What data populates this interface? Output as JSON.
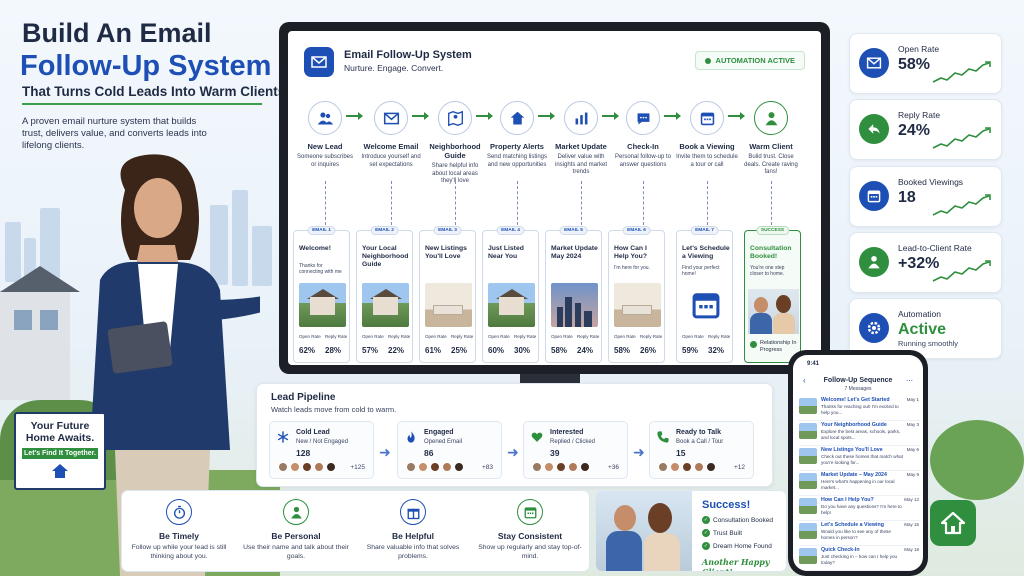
{
  "hero": {
    "title_line1": "Build An Email",
    "title_line2": "Follow-Up System",
    "title_line3": "That Turns Cold Leads Into Warm Clients",
    "description": "A proven email nurture system that builds trust, delivers value, and converts leads into lifelong clients."
  },
  "yard_sign": {
    "line1": "Your Future",
    "line2": "Home Awaits.",
    "band": "Let's Find It Together."
  },
  "app": {
    "title": "Email Follow-Up System",
    "subtitle": "Nurture. Engage. Convert.",
    "status": "AUTOMATION ACTIVE"
  },
  "steps": [
    {
      "name": "New Lead",
      "desc": "Someone subscribes or inquires",
      "icon": "people-icon"
    },
    {
      "name": "Welcome Email",
      "desc": "Introduce yourself and set expectations",
      "icon": "envelope-icon"
    },
    {
      "name": "Neighborhood Guide",
      "desc": "Share helpful info about local areas they'll love",
      "icon": "map-icon"
    },
    {
      "name": "Property Alerts",
      "desc": "Send matching listings and new opportunities",
      "icon": "house-icon"
    },
    {
      "name": "Market Update",
      "desc": "Deliver value with insights and market trends",
      "icon": "bar-chart-icon"
    },
    {
      "name": "Check-In",
      "desc": "Personal follow-up to answer questions",
      "icon": "chat-icon"
    },
    {
      "name": "Book a Viewing",
      "desc": "Invite them to schedule a tour or call",
      "icon": "calendar-icon"
    },
    {
      "name": "Warm Client",
      "desc": "Build trust. Close deals. Create raving fans!",
      "icon": "person-icon"
    }
  ],
  "emails": [
    {
      "tag": "EMAIL 1",
      "title": "Welcome!",
      "sub": "Thanks for connecting with me",
      "open_label": "Open Rate",
      "reply_label": "Reply Rate",
      "open": "62%",
      "reply": "28%"
    },
    {
      "tag": "EMAIL 2",
      "title": "Your Local Neighborhood Guide",
      "sub": "",
      "open_label": "Open Rate",
      "reply_label": "Reply Rate",
      "open": "57%",
      "reply": "22%"
    },
    {
      "tag": "EMAIL 3",
      "title": "New Listings You'll Love",
      "sub": "",
      "open_label": "Open Rate",
      "reply_label": "Reply Rate",
      "open": "61%",
      "reply": "25%"
    },
    {
      "tag": "EMAIL 4",
      "title": "Just Listed Near You",
      "sub": "",
      "open_label": "Open Rate",
      "reply_label": "Reply Rate",
      "open": "60%",
      "reply": "30%"
    },
    {
      "tag": "EMAIL 5",
      "title": "Market Update May 2024",
      "sub": "",
      "open_label": "Open Rate",
      "reply_label": "Reply Rate",
      "open": "58%",
      "reply": "24%"
    },
    {
      "tag": "EMAIL 6",
      "title": "How Can I Help You?",
      "sub": "I'm here for you.",
      "open_label": "Open Rate",
      "reply_label": "Reply Rate",
      "open": "58%",
      "reply": "26%"
    },
    {
      "tag": "EMAIL 7",
      "title": "Let's Schedule a Viewing",
      "sub": "Find your perfect home!",
      "open_label": "Open Rate",
      "reply_label": "Reply Rate",
      "open": "59%",
      "reply": "32%"
    }
  ],
  "success_card": {
    "tag": "SUCCESS",
    "title": "Consultation Booked!",
    "sub": "You're one step closer to home.",
    "footer": "Relationship In Progress"
  },
  "metrics": [
    {
      "label": "Open Rate",
      "value": "58%",
      "color": "#1d4fb5",
      "icon": "envelope-icon"
    },
    {
      "label": "Reply Rate",
      "value": "24%",
      "color": "#2f8f3e",
      "icon": "reply-icon"
    },
    {
      "label": "Booked Viewings",
      "value": "18",
      "color": "#1d4fb5",
      "icon": "calendar-icon"
    },
    {
      "label": "Lead-to-Client Rate",
      "value": "+32%",
      "color": "#2f8f3e",
      "icon": "person-icon"
    }
  ],
  "automation": {
    "label": "Automation",
    "value": "Active",
    "sub": "Running smoothly"
  },
  "pipeline": {
    "title": "Lead Pipeline",
    "subtitle": "Watch leads move from cold to warm.",
    "stages": [
      {
        "name": "Cold Lead",
        "desc": "New / Not Engaged",
        "count": "128",
        "more": "+125",
        "icon": "snowflake-icon"
      },
      {
        "name": "Engaged",
        "desc": "Opened Email",
        "count": "86",
        "more": "+83",
        "icon": "flame-icon"
      },
      {
        "name": "Interested",
        "desc": "Replied / Clicked",
        "count": "39",
        "more": "+36",
        "icon": "heart-icon"
      },
      {
        "name": "Ready to Talk",
        "desc": "Book a Call / Tour",
        "count": "15",
        "more": "+12",
        "icon": "phone-icon"
      }
    ]
  },
  "tips": [
    {
      "name": "Be Timely",
      "desc": "Follow up while your lead is still thinking about you.",
      "icon": "stopwatch-icon"
    },
    {
      "name": "Be Personal",
      "desc": "Use their name and talk about their goals.",
      "icon": "person-icon"
    },
    {
      "name": "Be Helpful",
      "desc": "Share valuable info that solves problems.",
      "icon": "gift-icon"
    },
    {
      "name": "Stay Consistent",
      "desc": "Show up regularly and stay top-of-mind.",
      "icon": "calendar-icon"
    }
  ],
  "success": {
    "title": "Success!",
    "items": [
      "Consultation Booked",
      "Trust Built",
      "Dream Home Found"
    ],
    "footer": "Another Happy Client!"
  },
  "phone": {
    "time": "9:41",
    "title": "Follow-Up Sequence",
    "count": "7 Messages",
    "items": [
      {
        "title": "Welcome! Let's Get Started",
        "desc": "Thanks for reaching out! I'm excited to help you...",
        "date": "May 1"
      },
      {
        "title": "Your Neighborhood Guide",
        "desc": "Explore the best areas, schools, parks, and local spots...",
        "date": "May 3"
      },
      {
        "title": "New Listings You'll Love",
        "desc": "Check out these homes that match what you're looking for...",
        "date": "May 6"
      },
      {
        "title": "Market Update – May 2024",
        "desc": "Here's what's happening in our local market...",
        "date": "May 9"
      },
      {
        "title": "How Can I Help You?",
        "desc": "Do you have any questions? I'm here to help!",
        "date": "May 12"
      },
      {
        "title": "Let's Schedule a Viewing",
        "desc": "Would you like to see any of these homes in person?",
        "date": "May 15"
      },
      {
        "title": "Quick Check-In",
        "desc": "Just checking in – how can I help you today?",
        "date": "May 18"
      }
    ]
  }
}
